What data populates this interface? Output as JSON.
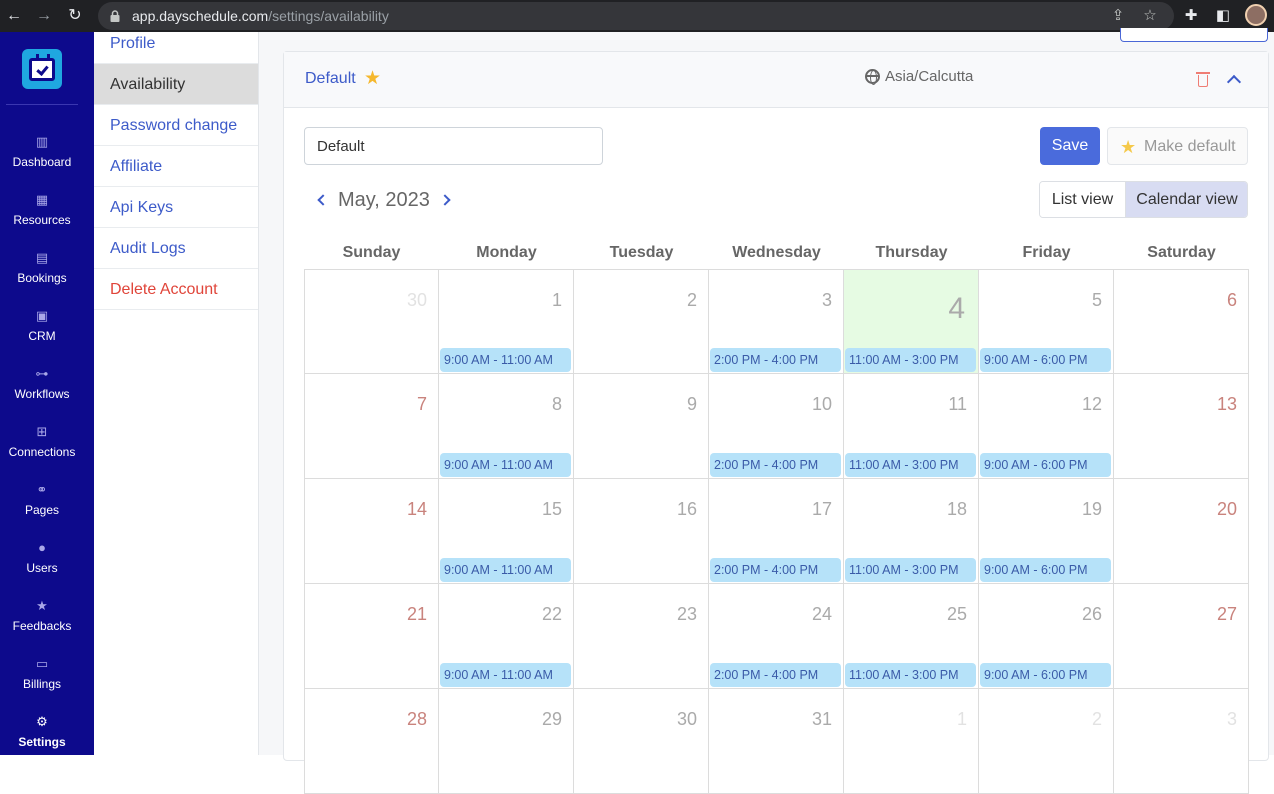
{
  "browser": {
    "url_host": "app.dayschedule.com",
    "url_path": "/settings/availability"
  },
  "app_nav": [
    {
      "label": "Dashboard",
      "icon": "chart-icon",
      "glyph": "▥"
    },
    {
      "label": "Resources",
      "icon": "grid-icon",
      "glyph": "▦"
    },
    {
      "label": "Bookings",
      "icon": "calendar-icon",
      "glyph": "▤"
    },
    {
      "label": "CRM",
      "icon": "contacts-icon",
      "glyph": "▣"
    },
    {
      "label": "Workflows",
      "icon": "workflow-icon",
      "glyph": "⊶"
    },
    {
      "label": "Connections",
      "icon": "network-icon",
      "glyph": "⊞"
    },
    {
      "label": "Pages",
      "icon": "link-icon",
      "glyph": "⚭"
    },
    {
      "label": "Users",
      "icon": "users-icon",
      "glyph": "●"
    },
    {
      "label": "Feedbacks",
      "icon": "star-icon",
      "glyph": "★"
    },
    {
      "label": "Billings",
      "icon": "billing-icon",
      "glyph": "▭"
    },
    {
      "label": "Settings",
      "icon": "settings-icon",
      "glyph": "⚙"
    }
  ],
  "settings_menu": [
    {
      "label": "Profile"
    },
    {
      "label": "Availability"
    },
    {
      "label": "Password change"
    },
    {
      "label": "Affiliate"
    },
    {
      "label": "Api Keys"
    },
    {
      "label": "Audit Logs"
    },
    {
      "label": "Delete Account"
    }
  ],
  "schedule": {
    "title": "Default",
    "timezone": "Asia/Calcutta",
    "name_value": "Default",
    "save_label": "Save",
    "make_default_label": "Make default"
  },
  "calendar": {
    "month_label": "May, 2023",
    "list_view_label": "List view",
    "calendar_view_label": "Calendar view",
    "weekdays": [
      "Sunday",
      "Monday",
      "Tuesday",
      "Wednesday",
      "Thursday",
      "Friday",
      "Saturday"
    ],
    "weeks": [
      [
        {
          "day": "30",
          "slot": ""
        },
        {
          "day": "1",
          "slot": "9:00 AM - 11:00 AM"
        },
        {
          "day": "2",
          "slot": ""
        },
        {
          "day": "3",
          "slot": "2:00 PM - 4:00 PM"
        },
        {
          "day": "4",
          "slot": "11:00 AM - 3:00 PM"
        },
        {
          "day": "5",
          "slot": "9:00 AM - 6:00 PM"
        },
        {
          "day": "6",
          "slot": ""
        }
      ],
      [
        {
          "day": "7",
          "slot": ""
        },
        {
          "day": "8",
          "slot": "9:00 AM - 11:00 AM"
        },
        {
          "day": "9",
          "slot": ""
        },
        {
          "day": "10",
          "slot": "2:00 PM - 4:00 PM"
        },
        {
          "day": "11",
          "slot": "11:00 AM - 3:00 PM"
        },
        {
          "day": "12",
          "slot": "9:00 AM - 6:00 PM"
        },
        {
          "day": "13",
          "slot": ""
        }
      ],
      [
        {
          "day": "14",
          "slot": ""
        },
        {
          "day": "15",
          "slot": "9:00 AM - 11:00 AM"
        },
        {
          "day": "16",
          "slot": ""
        },
        {
          "day": "17",
          "slot": "2:00 PM - 4:00 PM"
        },
        {
          "day": "18",
          "slot": "11:00 AM - 3:00 PM"
        },
        {
          "day": "19",
          "slot": "9:00 AM - 6:00 PM"
        },
        {
          "day": "20",
          "slot": ""
        }
      ],
      [
        {
          "day": "21",
          "slot": ""
        },
        {
          "day": "22",
          "slot": "9:00 AM - 11:00 AM"
        },
        {
          "day": "23",
          "slot": ""
        },
        {
          "day": "24",
          "slot": "2:00 PM - 4:00 PM"
        },
        {
          "day": "25",
          "slot": "11:00 AM - 3:00 PM"
        },
        {
          "day": "26",
          "slot": "9:00 AM - 6:00 PM"
        },
        {
          "day": "27",
          "slot": ""
        }
      ],
      [
        {
          "day": "28",
          "slot": ""
        },
        {
          "day": "29",
          "slot": ""
        },
        {
          "day": "30",
          "slot": ""
        },
        {
          "day": "31",
          "slot": ""
        },
        {
          "day": "1",
          "slot": ""
        },
        {
          "day": "2",
          "slot": ""
        },
        {
          "day": "3",
          "slot": ""
        }
      ]
    ]
  },
  "colors": {
    "sidebar_bg": "#0d0a8c",
    "accent": "#4a6bdc",
    "slot_bg": "#b6e2f9",
    "today_bg": "#e6fbe3",
    "danger": "#e0453a"
  }
}
